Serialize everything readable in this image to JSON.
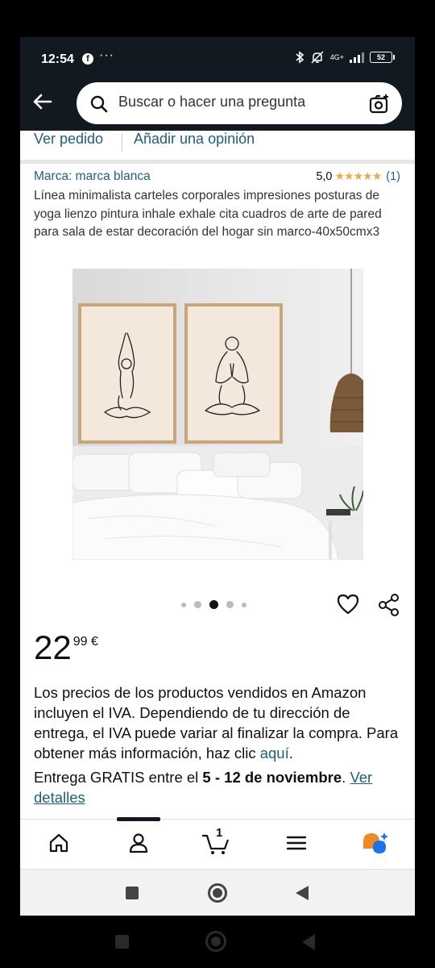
{
  "status": {
    "time": "12:54",
    "more": "···",
    "network": "4G+",
    "battery": "52"
  },
  "search": {
    "placeholder": "Buscar o hacer una pregunta"
  },
  "links": {
    "order": "Ver pedido",
    "review": "Añadir una opinión"
  },
  "product": {
    "brand": "Marca: marca blanca",
    "rating": "5,0",
    "stars": "★★★★★",
    "rating_count": "(1)",
    "title": "Línea minimalista carteles corporales impresiones posturas de yoga lienzo pintura inhale exhale cita cuadros de arte de pared para sala de estar decoración del hogar sin marco-40x50cmx3",
    "image_index": 3,
    "image_count": 5,
    "price_whole": "22",
    "price_fraction": "99 €"
  },
  "vat": {
    "text": "Los precios de los productos vendidos en Amazon incluyen el IVA. Dependiendo de tu dirección de entrega, el IVA puede variar al finalizar la compra. Para obtener más información, haz clic ",
    "link": "aquí",
    "end": "."
  },
  "delivery": {
    "prefix": "Entrega GRATIS entre el ",
    "dates": "5 - 12 de noviembre",
    "suffix": ". ",
    "link": "Ver detalles"
  },
  "nav": {
    "cart_count": "1",
    "items": [
      "home-icon",
      "account-icon",
      "cart-icon",
      "menu-icon",
      "rufus-icon"
    ]
  },
  "colors": {
    "header": "#131921",
    "link": "#1f5e82",
    "star": "#f3a847",
    "rufus_orange": "#f08a24",
    "rufus_blue": "#1a73e8"
  }
}
